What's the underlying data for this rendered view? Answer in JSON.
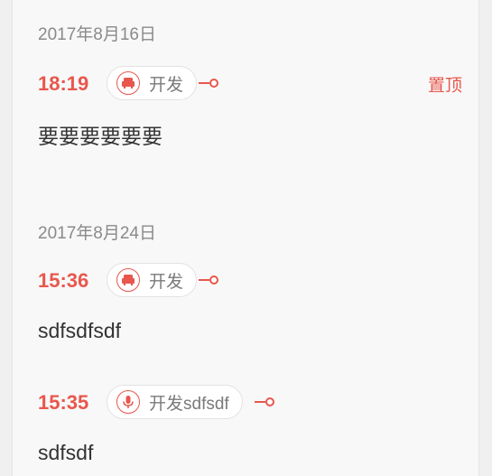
{
  "groups": [
    {
      "date": "2017年8月16日",
      "entries": [
        {
          "time": "18:19",
          "tag": "开发",
          "tag_icon": "sofa-icon",
          "pin_label": "置顶",
          "content": "要要要要要要"
        }
      ]
    },
    {
      "date": "2017年8月24日",
      "entries": [
        {
          "time": "15:36",
          "tag": "开发",
          "tag_icon": "sofa-icon",
          "content": "sdfsdfsdf"
        },
        {
          "time": "15:35",
          "tag": "开发sdfsdf",
          "tag_icon": "microphone-icon",
          "content": "sdfsdf"
        }
      ]
    }
  ],
  "accent_color": "#e8574d"
}
